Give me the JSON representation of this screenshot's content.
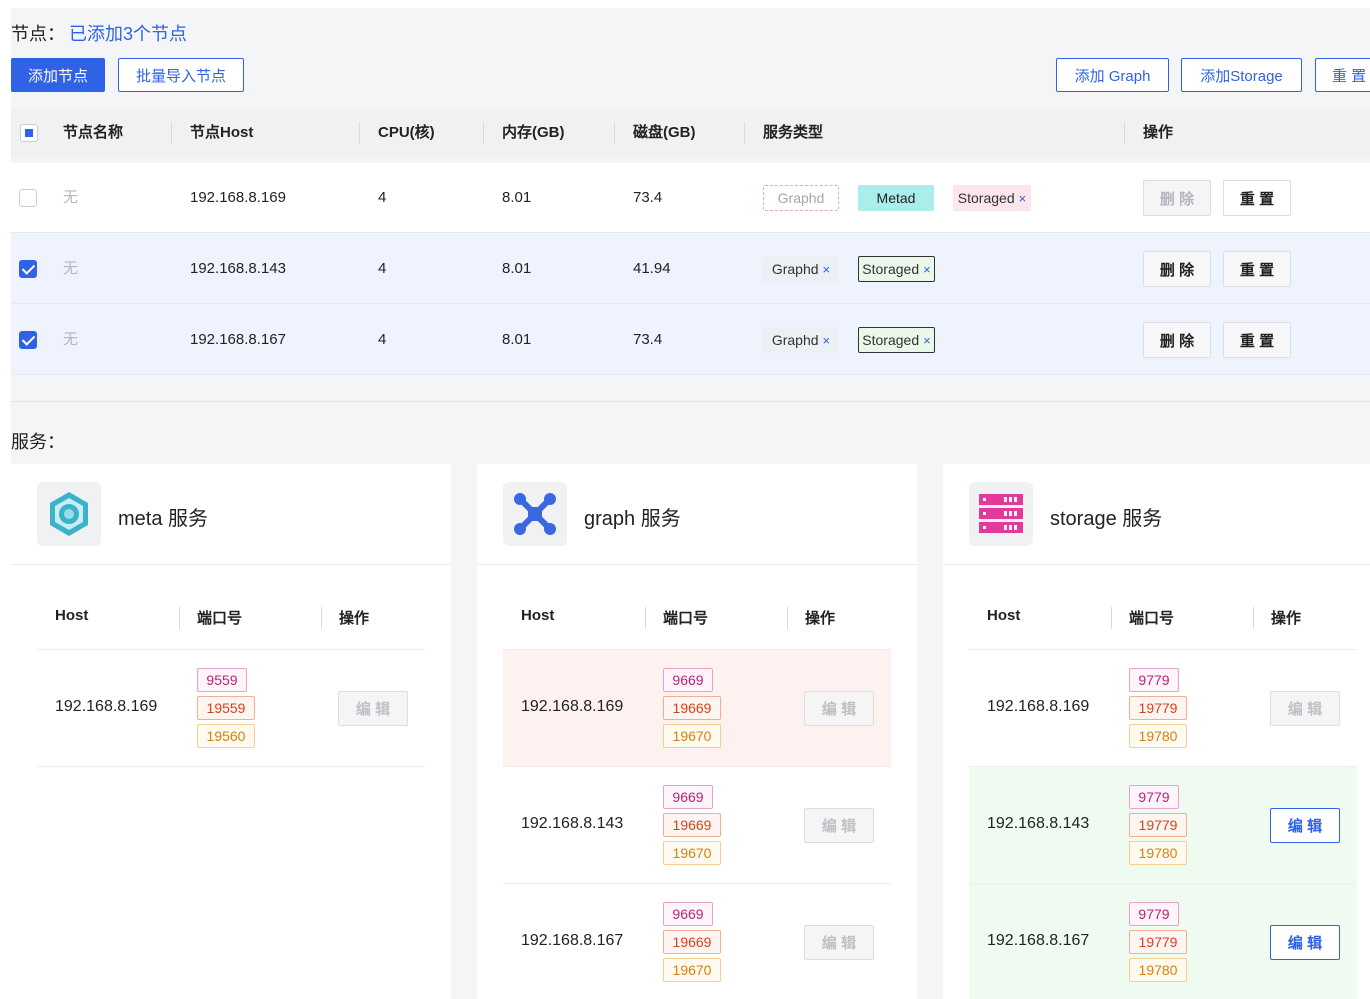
{
  "header": {
    "nodes_label": "节点：",
    "nodes_count": "已添加3个节点"
  },
  "toolbar": {
    "add_node": "添加节点",
    "import_nodes": "批量导入节点",
    "add_graph": "添加 Graph",
    "add_storage": "添加Storage",
    "reset": "重 置"
  },
  "table": {
    "columns": [
      "节点名称",
      "节点Host",
      "CPU(核)",
      "内存(GB)",
      "磁盘(GB)",
      "服务类型",
      "操作"
    ],
    "rows": [
      {
        "checked": false,
        "name": "无",
        "host": "192.168.8.169",
        "cpu": "4",
        "memory": "8.01",
        "disk": "73.4",
        "services": [
          "Graphd",
          "Metad",
          "Storaged"
        ],
        "delete_label": "删 除",
        "delete_enabled": false,
        "reset_label": "重 置"
      },
      {
        "checked": true,
        "name": "无",
        "host": "192.168.8.143",
        "cpu": "4",
        "memory": "8.01",
        "disk": "41.94",
        "services": [
          "Graphd",
          "Storaged"
        ],
        "delete_label": "删 除",
        "delete_enabled": true,
        "reset_label": "重 置"
      },
      {
        "checked": true,
        "name": "无",
        "host": "192.168.8.167",
        "cpu": "4",
        "memory": "8.01",
        "disk": "73.4",
        "services": [
          "Graphd",
          "Storaged"
        ],
        "delete_label": "删 除",
        "delete_enabled": true,
        "reset_label": "重 置"
      }
    ]
  },
  "services_label": "服务：",
  "service_cards": [
    {
      "title": "meta 服务",
      "icon": "meta-hexagon-icon",
      "columns": [
        "Host",
        "端口号",
        "操作"
      ],
      "rows": [
        {
          "host": "192.168.8.169",
          "ports": [
            "9559",
            "19559",
            "19560"
          ],
          "edit_label": "编 辑",
          "edit_enabled": false
        }
      ]
    },
    {
      "title": "graph 服务",
      "icon": "graph-network-icon",
      "columns": [
        "Host",
        "端口号",
        "操作"
      ],
      "rows": [
        {
          "host": "192.168.8.169",
          "ports": [
            "9669",
            "19669",
            "19670"
          ],
          "edit_label": "编 辑",
          "edit_enabled": false
        },
        {
          "host": "192.168.8.143",
          "ports": [
            "9669",
            "19669",
            "19670"
          ],
          "edit_label": "编 辑",
          "edit_enabled": false
        },
        {
          "host": "192.168.8.167",
          "ports": [
            "9669",
            "19669",
            "19670"
          ],
          "edit_label": "编 辑",
          "edit_enabled": false
        }
      ]
    },
    {
      "title": "storage 服务",
      "icon": "storage-server-icon",
      "columns": [
        "Host",
        "端口号",
        "操作"
      ],
      "rows": [
        {
          "host": "192.168.8.169",
          "ports": [
            "9779",
            "19779",
            "19780"
          ],
          "edit_label": "编 辑",
          "edit_enabled": false
        },
        {
          "host": "192.168.8.143",
          "ports": [
            "9779",
            "19779",
            "19780"
          ],
          "edit_label": "编 辑",
          "edit_enabled": true
        },
        {
          "host": "192.168.8.167",
          "ports": [
            "9779",
            "19779",
            "19780"
          ],
          "edit_label": "编 辑",
          "edit_enabled": true
        }
      ]
    }
  ],
  "colors": {
    "primary": "#2f62e4",
    "selected_row": "#eef3fd",
    "meta_icon": "#3bb2c9",
    "graph_icon": "#3a68e0",
    "storage_icon": "#e2399a"
  }
}
